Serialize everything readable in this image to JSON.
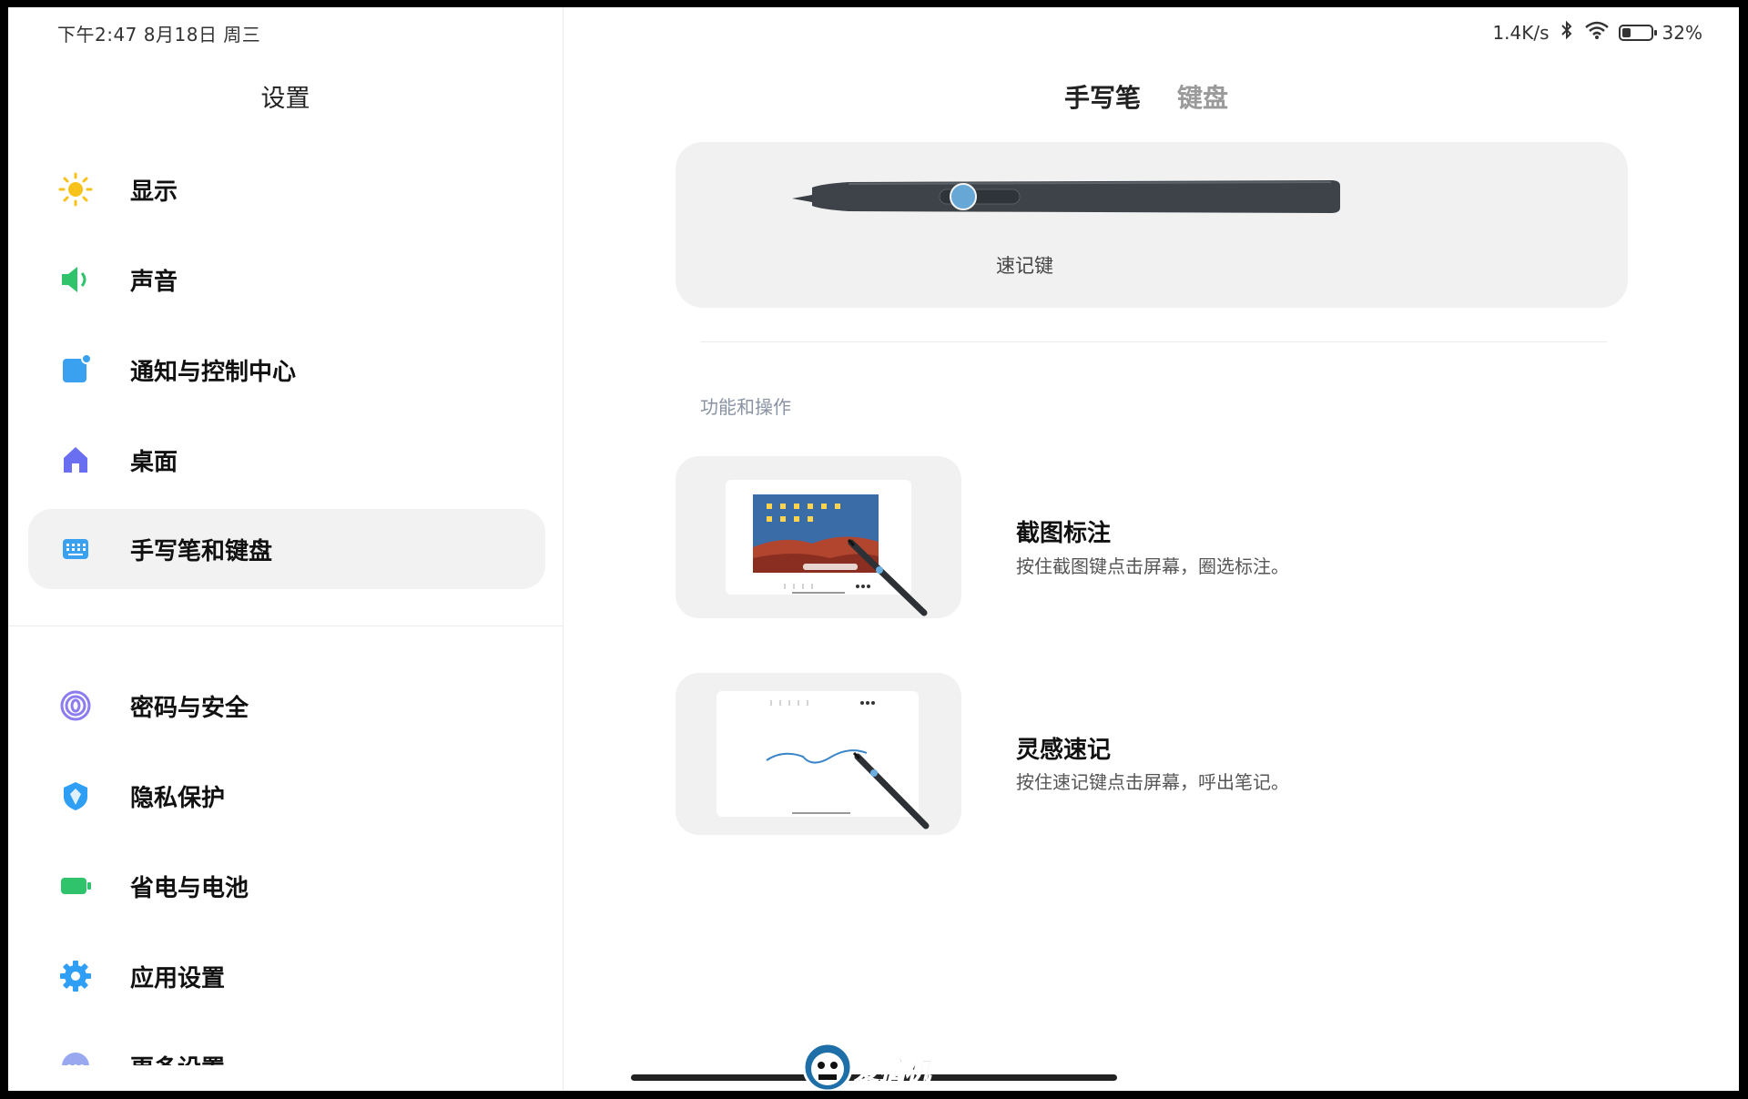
{
  "status": {
    "time_date": "下午2:47  8月18日 周三",
    "net_speed": "1.4K/s",
    "battery_pct": "32%",
    "battery_level": 0.32
  },
  "sidebar": {
    "title": "设置",
    "items": [
      {
        "label": "显示",
        "icon": "sun-icon"
      },
      {
        "label": "声音",
        "icon": "speaker-icon"
      },
      {
        "label": "通知与控制中心",
        "icon": "notification-icon"
      },
      {
        "label": "桌面",
        "icon": "home-icon"
      },
      {
        "label": "手写笔和键盘",
        "icon": "keyboard-icon",
        "active": true
      },
      {
        "label": "密码与安全",
        "icon": "fingerprint-icon"
      },
      {
        "label": "隐私保护",
        "icon": "privacy-shield-icon"
      },
      {
        "label": "省电与电池",
        "icon": "battery-icon"
      },
      {
        "label": "应用设置",
        "icon": "gear-icon"
      },
      {
        "label": "更多设置",
        "icon": "more-icon"
      }
    ]
  },
  "main": {
    "tabs": [
      {
        "label": "手写笔",
        "active": true
      },
      {
        "label": "键盘",
        "active": false
      }
    ],
    "pen": {
      "button_label": "速记键"
    },
    "section_title": "功能和操作",
    "features": [
      {
        "title": "截图标注",
        "desc": "按住截图键点击屏幕，圈选标注。"
      },
      {
        "title": "灵感速记",
        "desc": "按住速记键点击屏幕，呼出笔记。"
      }
    ]
  },
  "watermark": {
    "logo_text": "爱搞机"
  },
  "colors": {
    "active_bg": "#f2f2f2",
    "sun": "#f7c21a",
    "sound": "#2fc46b",
    "notify": "#3aa0f0",
    "home": "#6a6ef0",
    "keyboard": "#3aa0f0",
    "security": "#8b7cf0",
    "privacy": "#2f9ef5",
    "power": "#2fc46b",
    "apps": "#2f9ef5"
  }
}
